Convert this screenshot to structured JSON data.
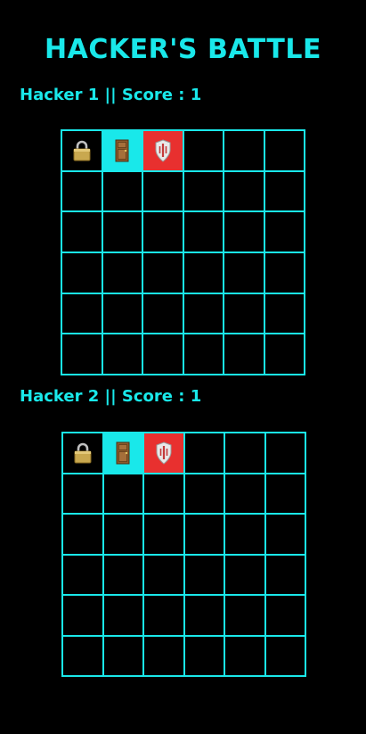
{
  "game": {
    "title": "HACKER'S BATTLE"
  },
  "colors": {
    "background": "#000000",
    "accent": "#19e8ea",
    "door_cell": "#19e8ea",
    "shield_cell": "#e8302f"
  },
  "players": [
    {
      "label": "Hacker 1 || Score : 1",
      "score": 1,
      "grid_size": 6,
      "icons_row0": [
        "lock-icon",
        "door-icon",
        "shield-icon"
      ]
    },
    {
      "label": "Hacker 2 || Score : 1",
      "score": 1,
      "grid_size": 6,
      "icons_row0": [
        "lock-icon",
        "door-icon",
        "shield-icon"
      ]
    }
  ]
}
